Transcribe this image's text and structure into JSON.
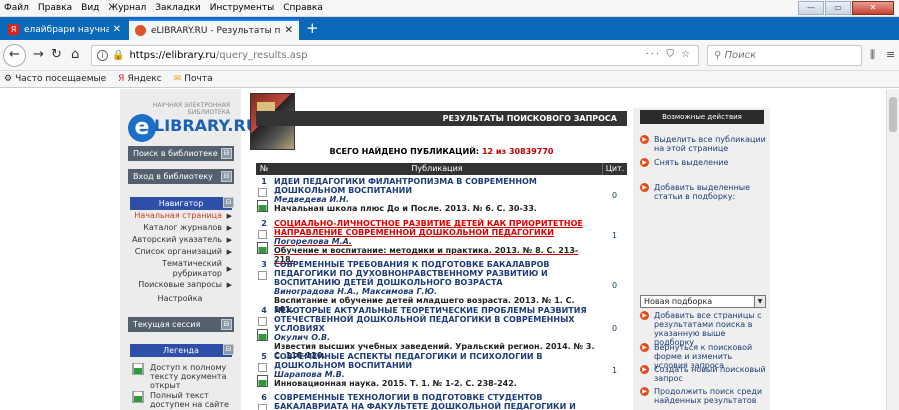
{
  "menubar": {
    "items": [
      {
        "label": "Файл",
        "key": "Ф"
      },
      {
        "label": "Правка",
        "key": "П"
      },
      {
        "label": "Вид",
        "key": "В"
      },
      {
        "label": "Журнал",
        "key": "Ж"
      },
      {
        "label": "Закладки",
        "key": "З"
      },
      {
        "label": "Инструменты",
        "key": "И"
      },
      {
        "label": "Справка",
        "key": "С"
      }
    ]
  },
  "tabs": [
    {
      "title": "елайбрари научная электрон",
      "state": "inactive",
      "icon_color": "#e2211c"
    },
    {
      "title": "eLIBRARY.RU - Результаты по",
      "state": "active",
      "icon_color": "#e0522a"
    }
  ],
  "newtab": "+",
  "url": {
    "host": "https://elibrary.ru",
    "path": "/query_results.asp",
    "dots": "···"
  },
  "search": {
    "placeholder": "Поиск"
  },
  "bookmarks": [
    {
      "label": "Часто посещаемые",
      "icon": "gear-icon"
    },
    {
      "label": "Яндекс",
      "icon": "yandex-icon"
    },
    {
      "label": "Почта",
      "icon": "mail-icon"
    }
  ],
  "sidebar": {
    "logo_line1": "НАУЧНАЯ ЭЛЕКТРОННАЯ",
    "logo_line2": "БИБЛИОТЕКА",
    "logo_letter": "e",
    "logo_text": "LIBRARY.RU",
    "search_btn": "Поиск в библиотеке",
    "login_btn": "Вход в библиотеку",
    "nav_head": "Навигатор",
    "nav_items": [
      {
        "label": "Начальная страница",
        "current": true
      },
      {
        "label": "Каталог журналов",
        "current": false
      },
      {
        "label": "Авторский указатель",
        "current": false
      },
      {
        "label": "Список организаций",
        "current": false
      },
      {
        "label": "Тематический рубрикатор",
        "current": false
      },
      {
        "label": "Поисковые запросы",
        "current": false
      },
      {
        "label": "Настройка",
        "current": false
      }
    ],
    "session_btn": "Текущая сессия",
    "legend_head": "Легенда",
    "legend_items": [
      "Доступ к полному тексту документа открыт",
      "Полный текст доступен на сайте"
    ],
    "toggle": "⊟"
  },
  "results": {
    "bar_title": "РЕЗУЛЬТАТЫ ПОИСКОВОГО ЗАПРОСА",
    "found_prefix": "ВСЕГО НАЙДЕНО ПУБЛИКАЦИЙ:",
    "found_count": "12",
    "found_sep": "из",
    "found_total": "30839770",
    "col_num": "№",
    "col_pub": "Публикация",
    "col_cit": "Цит.",
    "rows": [
      {
        "n": "1",
        "title": "ИДЕИ ПЕДАГОГИКИ ФИЛАНТРОПИЗМА В СОВРЕМЕННОМ ДОШКОЛЬНОМ ВОСПИТАНИИ",
        "authors": "Медведева И.Н.",
        "source": "Начальная школа плюс До и После. 2013. № 6. С. 30-33.",
        "cit": "0",
        "highlight": false
      },
      {
        "n": "2",
        "title": "СОЦИАЛЬНО-ЛИЧНОСТНОЕ РАЗВИТИЕ ДЕТЕЙ КАК ПРИОРИТЕТНОЕ НАПРАВЛЕНИЕ СОВРЕМЕННОЙ ДОШКОЛЬНОЙ ПЕДАГОГИКИ",
        "authors": "Погорелова М.А.",
        "source": "Обучение и воспитание: методики и практика. 2013. № 8. С. 213-218.",
        "cit": "1",
        "highlight": true
      },
      {
        "n": "3",
        "title": "СОВРЕМЕННЫЕ ТРЕБОВАНИЯ К ПОДГОТОВКЕ БАКАЛАВРОВ ПЕДАГОГИКИ ПО ДУХОВНОНРАВСТВЕННОМУ РАЗВИТИЮ И ВОСПИТАНИЮ ДЕТЕЙ ДОШКОЛЬНОГО ВОЗРАСТА",
        "authors": "Виноградова Н.А., Максимова Г.Ю.",
        "source": "Воспитание и обучение детей младшего возраста. 2013. № 1. С. 101.",
        "cit": "0",
        "highlight": false
      },
      {
        "n": "4",
        "title": "НЕКОТОРЫЕ АКТУАЛЬНЫЕ ТЕОРЕТИЧЕСКИЕ ПРОБЛЕМЫ РАЗВИТИЯ ОТЕЧЕСТВЕННОЙ ДОШКОЛЬНОЙ ПЕДАГОГИКИ В СОВРЕМЕННЫХ УСЛОВИЯХ",
        "authors": "Окулич О.В.",
        "source": "Известия высших учебных заведений. Уральский регион. 2014. № 3. С. 118-120.",
        "cit": "0",
        "highlight": false
      },
      {
        "n": "5",
        "title": "СОВРЕМЕННЫЕ АСПЕКТЫ ПЕДАГОГИКИ И ПСИХОЛОГИИ В ДОШКОЛЬНОМ ВОСПИТАНИИ",
        "authors": "Шарапова М.В.",
        "source": "Инновационная наука. 2015. Т. 1. № 1-2. С. 238-242.",
        "cit": "1",
        "highlight": false
      },
      {
        "n": "6",
        "title": "СОВРЕМЕННЫЕ ТЕХНОЛОГИИ В ПОДГОТОВКЕ СТУДЕНТОВ БАКАЛАВРИАТА НА ФАКУЛЬТЕТЕ ДОШКОЛЬНОЙ ПЕДАГОГИКИ И ПСИХОЛОГИИ МПГУ",
        "authors": "",
        "source": "",
        "cit": "",
        "highlight": false
      }
    ]
  },
  "actions": {
    "head": "Возможные действия",
    "items": [
      "Выделить все публикации на этой странице",
      "Снять выделение",
      "Добавить выделенные статьи в подборку:",
      "Добавить все страницы с результатами поиска в указанную выше подборку",
      "Вернуться к поисковой форме и изменить условия запроса",
      "Создать новый поисковый запрос",
      "Продолжить поиск среди найденных результатов"
    ],
    "select_value": "Новая подборка"
  },
  "colors": {
    "accent": "#1c61b5",
    "tabbar": "#0b68b8",
    "highlight_title": "#e10000",
    "action_bullet": "#e34b1c"
  }
}
